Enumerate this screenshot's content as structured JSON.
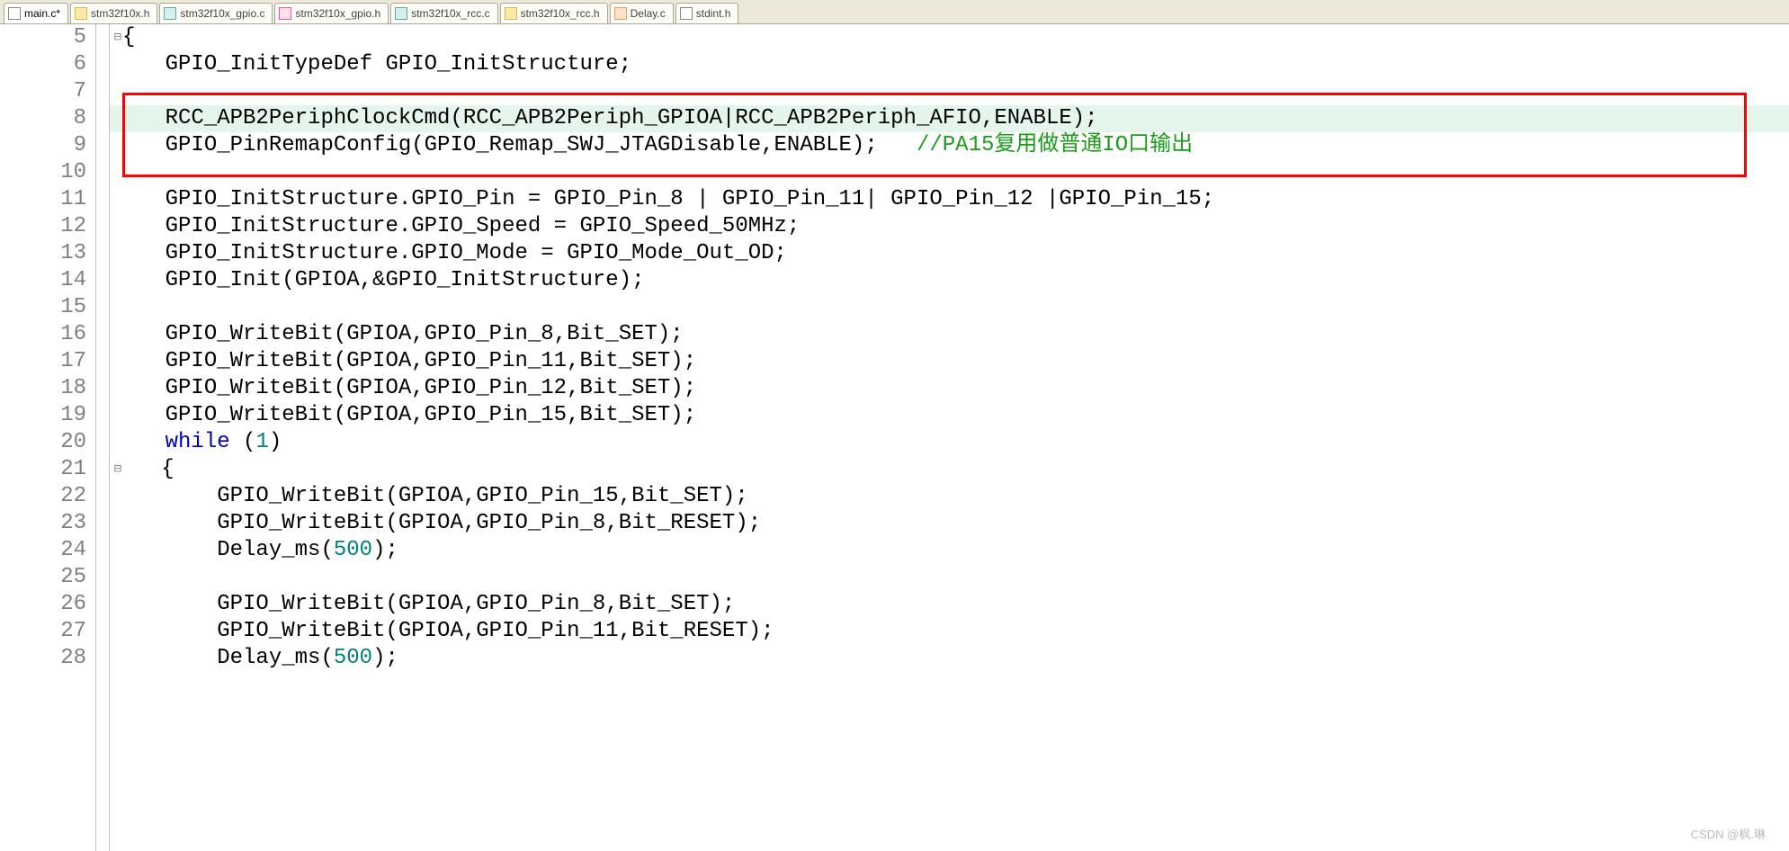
{
  "tabs": [
    {
      "label": "main.c*"
    },
    {
      "label": "stm32f10x.h"
    },
    {
      "label": "stm32f10x_gpio.c"
    },
    {
      "label": "stm32f10x_gpio.h"
    },
    {
      "label": "stm32f10x_rcc.c"
    },
    {
      "label": "stm32f10x_rcc.h"
    },
    {
      "label": "Delay.c"
    },
    {
      "label": "stdint.h"
    }
  ],
  "lines": [
    {
      "num": "5",
      "text": "{"
    },
    {
      "num": "6",
      "text": "    GPIO_InitTypeDef GPIO_InitStructure;"
    },
    {
      "num": "7",
      "text": ""
    },
    {
      "num": "8",
      "text": "    RCC_APB2PeriphClockCmd(RCC_APB2Periph_GPIOA|RCC_APB2Periph_AFIO,ENABLE);"
    },
    {
      "num": "9",
      "pre": "    GPIO_PinRemapConfig(GPIO_Remap_SWJ_JTAGDisable,ENABLE);   ",
      "cmt": "//PA15复用做普通IO口输出"
    },
    {
      "num": "10",
      "text": ""
    },
    {
      "num": "11",
      "text": "    GPIO_InitStructure.GPIO_Pin = GPIO_Pin_8 | GPIO_Pin_11| GPIO_Pin_12 |GPIO_Pin_15;"
    },
    {
      "num": "12",
      "text": "    GPIO_InitStructure.GPIO_Speed = GPIO_Speed_50MHz;"
    },
    {
      "num": "13",
      "text": "    GPIO_InitStructure.GPIO_Mode = GPIO_Mode_Out_OD;"
    },
    {
      "num": "14",
      "text": "    GPIO_Init(GPIOA,&GPIO_InitStructure);"
    },
    {
      "num": "15",
      "text": ""
    },
    {
      "num": "16",
      "text": "    GPIO_WriteBit(GPIOA,GPIO_Pin_8,Bit_SET);"
    },
    {
      "num": "17",
      "text": "    GPIO_WriteBit(GPIOA,GPIO_Pin_11,Bit_SET);"
    },
    {
      "num": "18",
      "text": "    GPIO_WriteBit(GPIOA,GPIO_Pin_12,Bit_SET);"
    },
    {
      "num": "19",
      "text": "    GPIO_WriteBit(GPIOA,GPIO_Pin_15,Bit_SET);"
    },
    {
      "num": "20",
      "pre": "    ",
      "kw": "while",
      "post": " (",
      "num2": "",
      "end": ")",
      "numKey": "1"
    },
    {
      "num": "21",
      "text": "   {"
    },
    {
      "num": "22",
      "text": "        GPIO_WriteBit(GPIOA,GPIO_Pin_15,Bit_SET);"
    },
    {
      "num": "23",
      "text": "        GPIO_WriteBit(GPIOA,GPIO_Pin_8,Bit_RESET);"
    },
    {
      "num": "24",
      "pre": "        Delay_ms(",
      "num2": "",
      "end": ");",
      "numKey": "500"
    },
    {
      "num": "25",
      "text": ""
    },
    {
      "num": "26",
      "text": "        GPIO_WriteBit(GPIOA,GPIO_Pin_8,Bit_SET);"
    },
    {
      "num": "27",
      "text": "        GPIO_WriteBit(GPIOA,GPIO_Pin_11,Bit_RESET);"
    },
    {
      "num": "28",
      "pre": "        Delay_ms(",
      "num2": "",
      "end": ");",
      "numKey": "500"
    }
  ],
  "watermark": "CSDN @枫.琳"
}
